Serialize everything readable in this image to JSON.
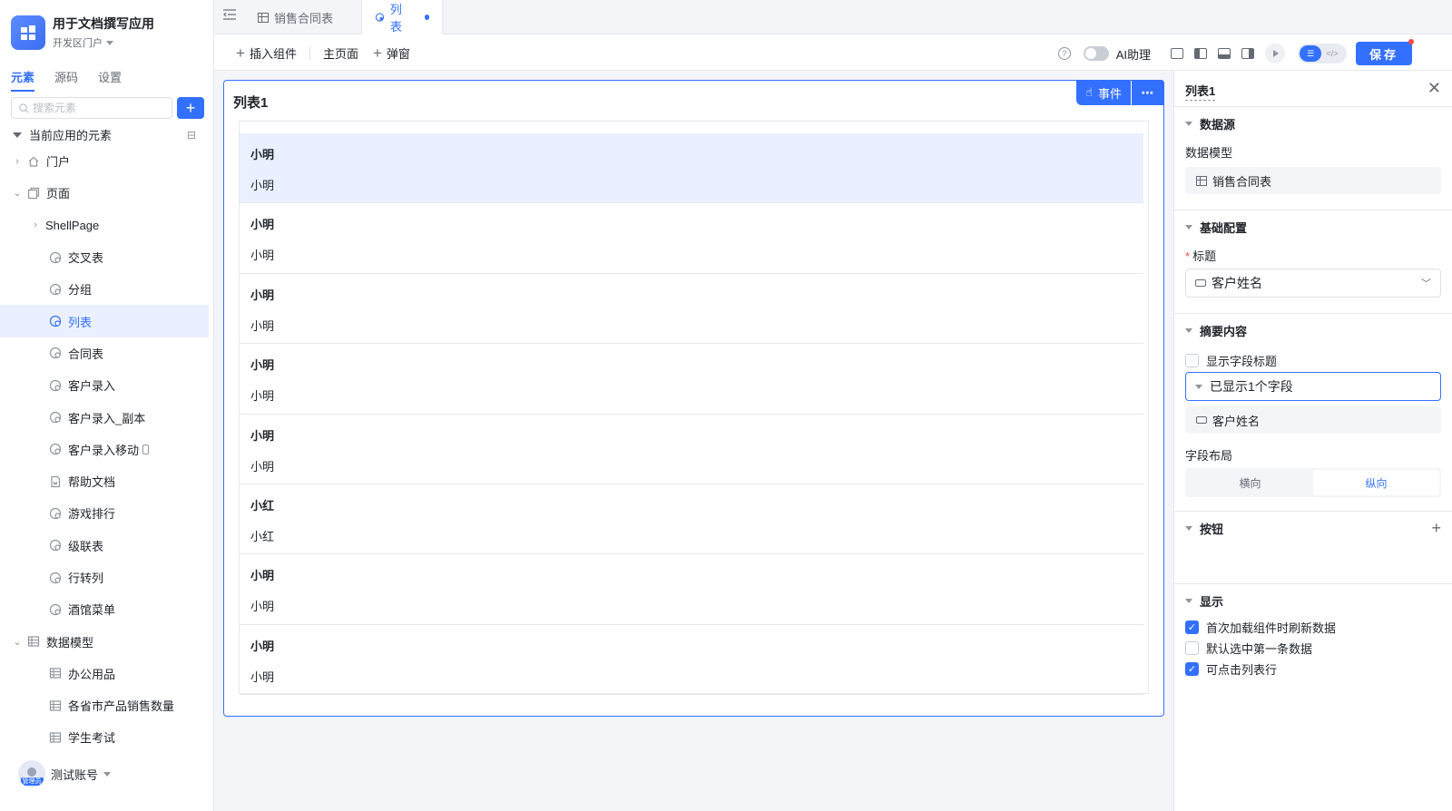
{
  "app": {
    "title": "用于文档撰写应用",
    "portal": "开发区门户"
  },
  "sidebar": {
    "tabs": [
      {
        "label": "元素",
        "active": true
      },
      {
        "label": "源码",
        "active": false
      },
      {
        "label": "设置",
        "active": false
      }
    ],
    "search_placeholder": "搜索元素",
    "tree_header": "当前应用的元素",
    "tree": [
      {
        "label": "门户",
        "level": 0,
        "chev": "›",
        "icon": "home-icon"
      },
      {
        "label": "页面",
        "level": 0,
        "chev": "⌄",
        "icon": "pages-icon"
      },
      {
        "label": "ShellPage",
        "level": 1,
        "chev": "›",
        "icon": ""
      },
      {
        "label": "交叉表",
        "level": 2,
        "icon": "page-icon"
      },
      {
        "label": "分组",
        "level": 2,
        "icon": "page-icon"
      },
      {
        "label": "列表",
        "level": 2,
        "icon": "page-icon",
        "selected": true
      },
      {
        "label": "合同表",
        "level": 2,
        "icon": "page-icon"
      },
      {
        "label": "客户录入",
        "level": 2,
        "icon": "page-icon"
      },
      {
        "label": "客户录入_副本",
        "level": 2,
        "icon": "page-icon"
      },
      {
        "label": "客户录入移动",
        "level": 2,
        "icon": "page-icon",
        "mobile": true
      },
      {
        "label": "帮助文档",
        "level": 2,
        "icon": "doc-icon"
      },
      {
        "label": "游戏排行",
        "level": 2,
        "icon": "page-icon"
      },
      {
        "label": "级联表",
        "level": 2,
        "icon": "page-icon"
      },
      {
        "label": "行转列",
        "level": 2,
        "icon": "page-icon"
      },
      {
        "label": "酒馆菜单",
        "level": 2,
        "icon": "page-icon"
      },
      {
        "label": "数据模型",
        "level": 0,
        "chev": "⌄",
        "icon": "table-icon"
      },
      {
        "label": "办公用品",
        "level": 2,
        "icon": "table-icon"
      },
      {
        "label": "各省市产品销售数量",
        "level": 2,
        "icon": "table-icon"
      },
      {
        "label": "学生考试",
        "level": 2,
        "icon": "table-icon"
      }
    ],
    "user": {
      "name": "测试账号",
      "role_tag": "管理员"
    }
  },
  "tabs": [
    {
      "label": "销售合同表",
      "icon": "table-icon"
    },
    {
      "label": "列表",
      "icon": "page-icon",
      "active": true,
      "modified": true
    }
  ],
  "toolbar": {
    "insert_component": "插入组件",
    "main_page": "主页面",
    "popup": "弹窗",
    "ai_assistant": "AI助理",
    "save": "保存"
  },
  "canvas": {
    "title": "列表1",
    "event_label": "事件",
    "more": "⋯",
    "rows": [
      {
        "title": "小明",
        "sub": "小明",
        "highlighted": true
      },
      {
        "title": "小明",
        "sub": "小明"
      },
      {
        "title": "小明",
        "sub": "小明"
      },
      {
        "title": "小明",
        "sub": "小明"
      },
      {
        "title": "小明",
        "sub": "小明"
      },
      {
        "title": "小红",
        "sub": "小红"
      },
      {
        "title": "小明",
        "sub": "小明"
      },
      {
        "title": "小明",
        "sub": "小明"
      }
    ]
  },
  "props": {
    "title": "列表1",
    "datasource": {
      "section": "数据源",
      "model_label": "数据模型",
      "model_value": "销售合同表"
    },
    "basic": {
      "section": "基础配置",
      "title_label": "标题",
      "title_value": "客户姓名"
    },
    "summary": {
      "section": "摘要内容",
      "show_field_title": "显示字段标题",
      "shown_fields": "已显示1个字段",
      "field": "客户姓名",
      "layout_label": "字段布局",
      "layout_options": [
        "横向",
        "纵向"
      ],
      "layout_selected": "纵向"
    },
    "buttons": {
      "section": "按钮"
    },
    "display": {
      "section": "显示",
      "options": [
        {
          "label": "首次加载组件时刷新数据",
          "checked": true
        },
        {
          "label": "默认选中第一条数据",
          "checked": false
        },
        {
          "label": "可点击列表行",
          "checked": true
        }
      ]
    }
  },
  "colors": {
    "accent": "#3370ff",
    "danger": "#f54a45"
  }
}
